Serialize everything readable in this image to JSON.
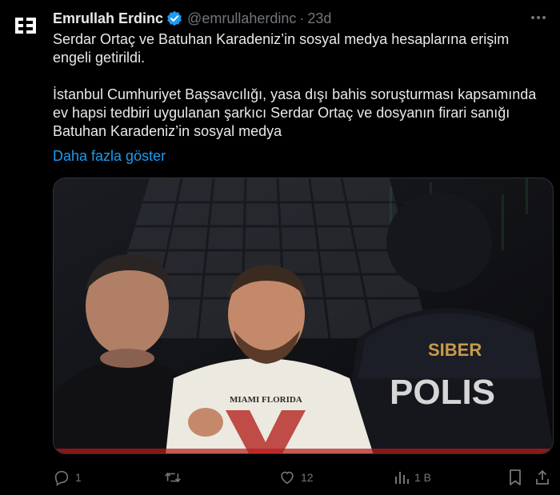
{
  "author": {
    "name": "Emrullah Erdinc",
    "handle": "@emrullaherdinc",
    "separator": "·",
    "time": "23d",
    "verified": true,
    "avatar_icon": "ee-logo-icon"
  },
  "tweet": {
    "line1": "Serdar Ortaç ve Batuhan Karadeniz’in sosyal medya hesaplarına erişim",
    "line2": "engeli getirildi.",
    "line3": "İstanbul Cumhuriyet Başsavcılığı, yasa dışı bahis soruşturması kapsamında",
    "line4": "ev hapsi tedbiri uygulanan şarkıcı Serdar Ortaç ve dosyanın firari sanığı",
    "line5": "Batuhan Karadeniz’in sosyal medya",
    "show_more": "Daha fazla göster"
  },
  "media": {
    "shirt_text": "MIAMI FLORIDA",
    "jacket_line1": "SIBER",
    "jacket_line2": "POLIS"
  },
  "actions": {
    "reply_count": "1",
    "repost_count": "",
    "like_count": "12",
    "views_count": "1 B"
  },
  "colors": {
    "background": "#000000",
    "text": "#e7e9ea",
    "muted": "#71767b",
    "link": "#1d9bf0"
  }
}
